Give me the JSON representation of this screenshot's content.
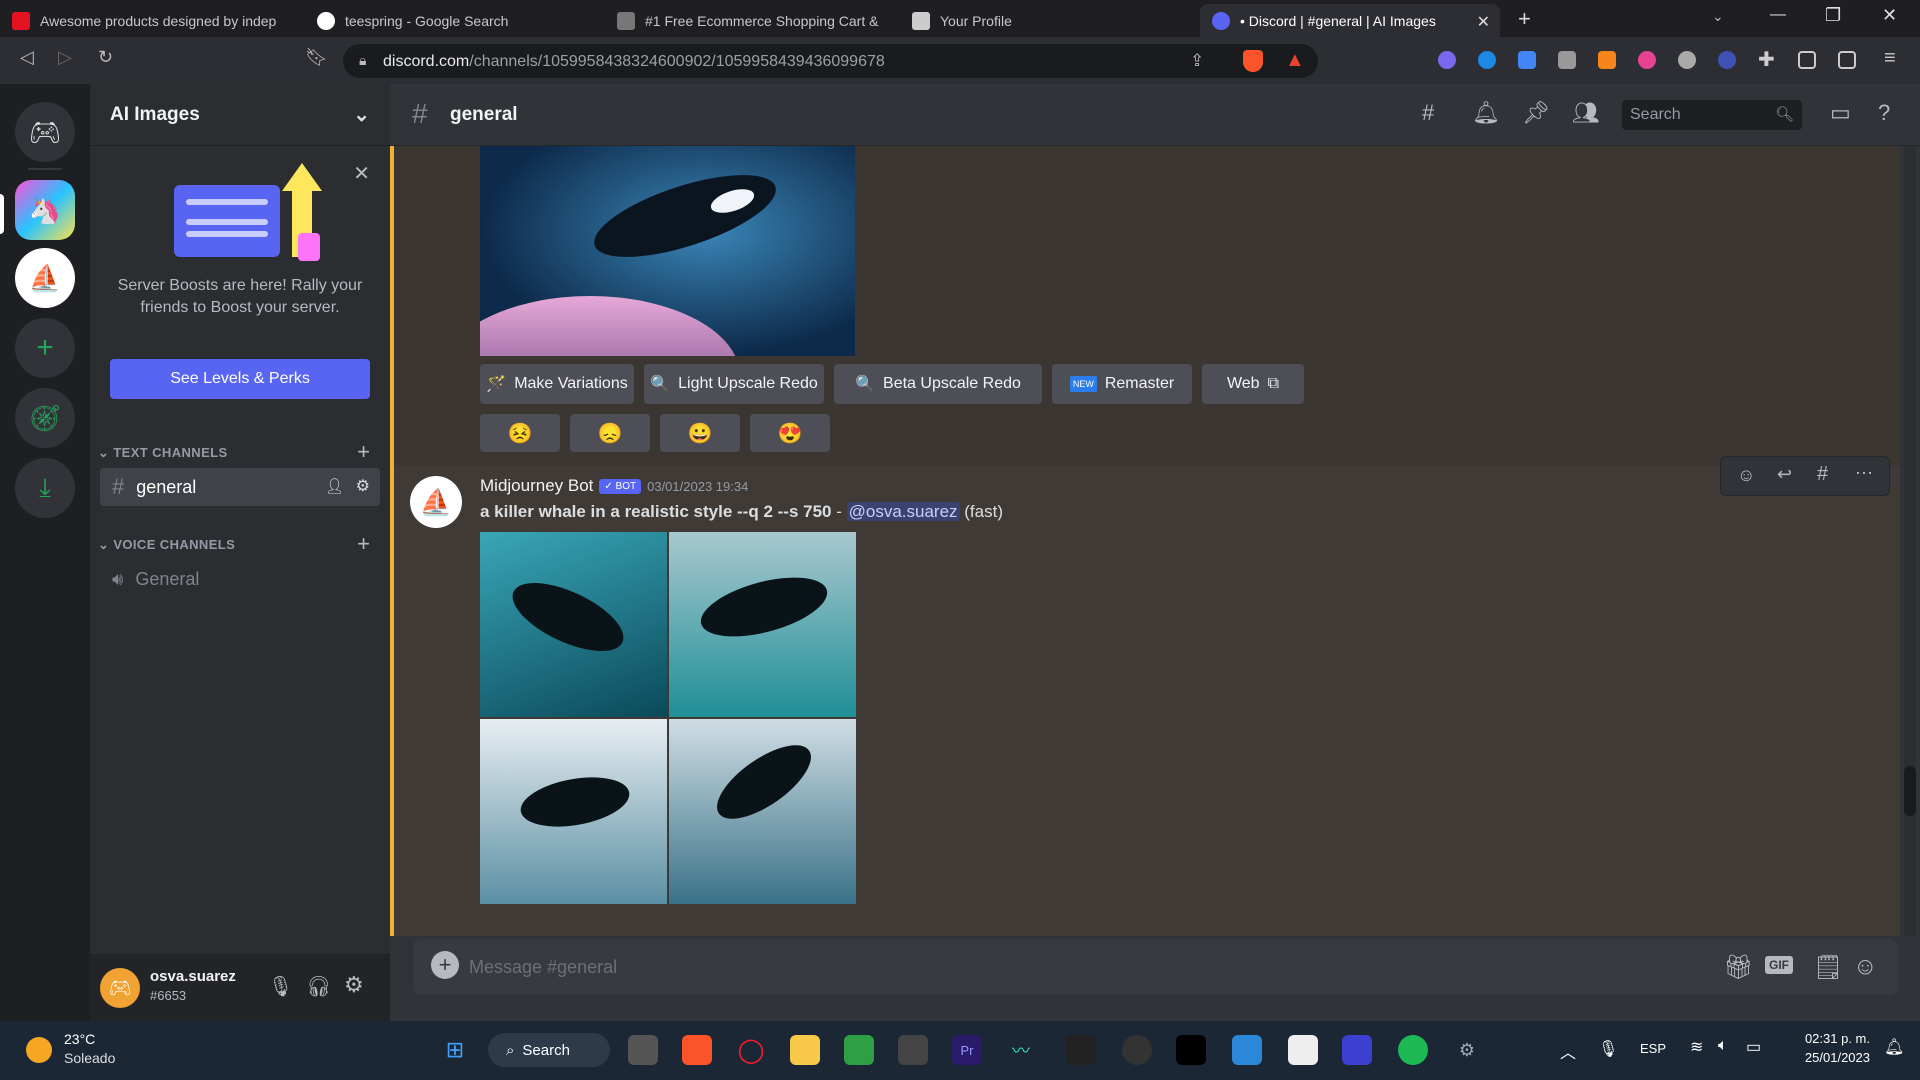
{
  "browser": {
    "tabs": [
      {
        "title": "Awesome products designed by indep",
        "favicon": "redbubble-icon",
        "color": "#e41321"
      },
      {
        "title": "teespring - Google Search",
        "favicon": "google-icon",
        "color": "#ffffff"
      },
      {
        "title": "#1 Free Ecommerce Shopping Cart &",
        "favicon": "cart-icon",
        "color": "#888888"
      },
      {
        "title": "Your Profile",
        "favicon": "profile-icon",
        "color": "#cccccc"
      },
      {
        "title": "• Discord | #general | AI Images",
        "favicon": "discord-icon",
        "color": "#5865f2"
      }
    ],
    "url_domain": "discord.com",
    "url_path": "/channels/1059958438324600902/1059958439436099678"
  },
  "server": {
    "name": "AI Images",
    "boost_text": "Server Boosts are here! Rally your friends to Boost your server.",
    "boost_button": "See Levels & Perks",
    "text_category": "TEXT CHANNELS",
    "voice_category": "VOICE CHANNELS",
    "text_channel": "general",
    "voice_channel": "General"
  },
  "user": {
    "name": "osva.suarez",
    "tag": "#6653"
  },
  "channel": {
    "name": "general",
    "search_placeholder": "Search",
    "composer_placeholder": "Message #general"
  },
  "prev_message": {
    "buttons": [
      "Make Variations",
      "Light Upscale Redo",
      "Beta Upscale Redo",
      "Remaster",
      "Web"
    ],
    "new_badge": "NEW",
    "reactions": [
      "😣",
      "😞",
      "😀",
      "😍"
    ]
  },
  "message": {
    "author": "Midjourney Bot",
    "badge": "✓ BOT",
    "timestamp": "03/01/2023 19:34",
    "prompt": "a killer whale in a realistic style --q 2 --s 750",
    "separator": " - ",
    "mention": "@osva.suarez",
    "mode": "(fast)"
  },
  "taskbar": {
    "weather_temp": "23°C",
    "weather_desc": "Soleado",
    "search": "Search",
    "lang": "ESP",
    "time": "02:31 p. m.",
    "date": "25/01/2023"
  }
}
